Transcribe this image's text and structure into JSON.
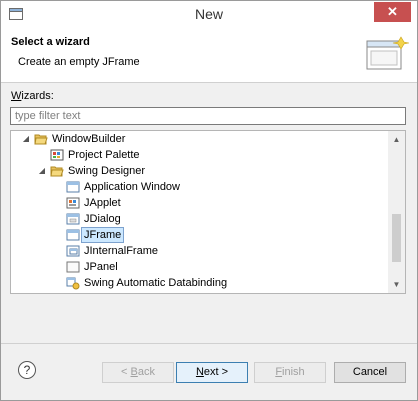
{
  "window": {
    "title": "New",
    "close_glyph": "✕"
  },
  "header": {
    "title": "Select a wizard",
    "description": "Create an empty JFrame",
    "icon": "wizard-banner-icon"
  },
  "filter": {
    "label_first": "W",
    "label_rest": "izards:",
    "placeholder": "type filter text",
    "value": ""
  },
  "tree": {
    "items": [
      {
        "label": "WindowBuilder",
        "icon": "folder-open-icon",
        "expanded": true
      },
      {
        "label": "Project Palette",
        "icon": "palette-icon"
      },
      {
        "label": "Swing Designer",
        "icon": "folder-open-icon",
        "expanded": true
      },
      {
        "label": "Application Window",
        "icon": "window-icon"
      },
      {
        "label": "JApplet",
        "icon": "applet-icon"
      },
      {
        "label": "JDialog",
        "icon": "dialog-icon"
      },
      {
        "label": "JFrame",
        "icon": "frame-icon",
        "selected": true
      },
      {
        "label": "JInternalFrame",
        "icon": "internal-frame-icon"
      },
      {
        "label": "JPanel",
        "icon": "panel-icon"
      },
      {
        "label": "Swing Automatic Databinding",
        "icon": "databinding-icon"
      }
    ]
  },
  "footer": {
    "help": "?",
    "back_prefix": "< ",
    "back_mnemonic": "B",
    "back_rest": "ack",
    "next_mnemonic": "N",
    "next_rest": "ext >",
    "finish_mnemonic": "F",
    "finish_rest": "inish",
    "cancel": "Cancel"
  },
  "colors": {
    "selection": "#cce8ff",
    "close": "#c75050",
    "accent": "#3c7fb1"
  }
}
